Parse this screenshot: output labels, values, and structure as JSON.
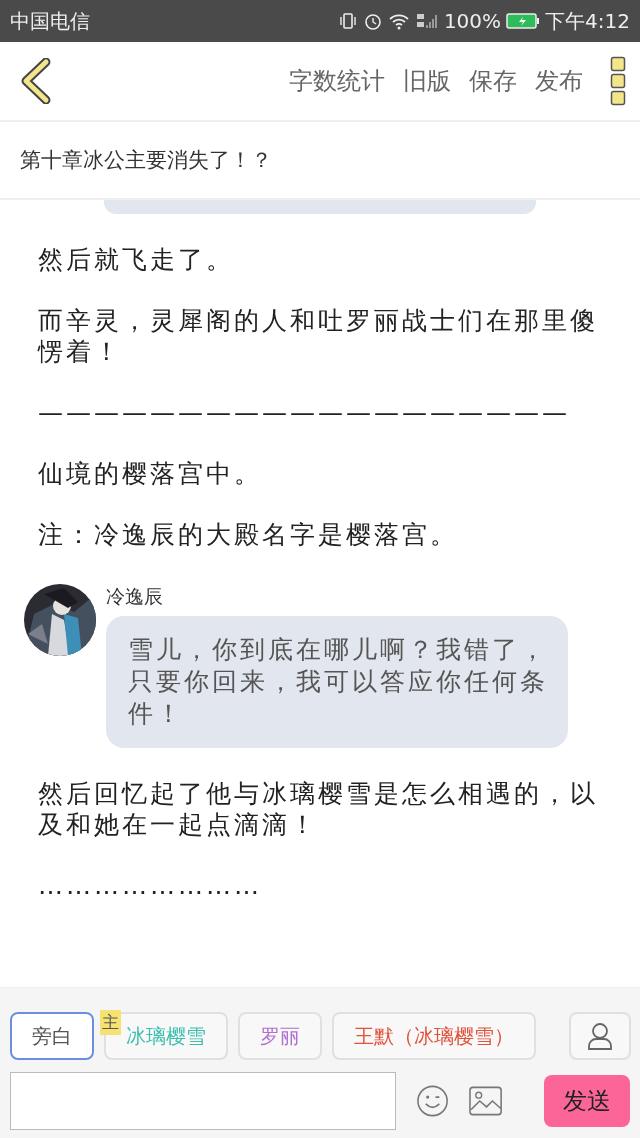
{
  "status_bar": {
    "carrier": "中国电信",
    "battery": "100%",
    "time": "下午4:12"
  },
  "toolbar": {
    "actions": [
      "字数统计",
      "旧版",
      "保存",
      "发布"
    ]
  },
  "chapter_title": "第十章冰公主要消失了！？",
  "content": [
    {
      "kind": "bubble_tail"
    },
    {
      "kind": "text",
      "text": "然后就飞走了。"
    },
    {
      "kind": "text",
      "text": "而辛灵，灵犀阁的人和吐罗丽战士们在那里傻愣着！"
    },
    {
      "kind": "text",
      "text": "———————————————————"
    },
    {
      "kind": "text",
      "text": "仙境的樱落宫中。"
    },
    {
      "kind": "text",
      "text": "注：冷逸辰的大殿名字是樱落宫。"
    },
    {
      "kind": "dialog",
      "speaker": "冷逸辰",
      "text": "雪儿，你到底在哪儿啊？我错了，只要你回来，我可以答应你任何条件！"
    },
    {
      "kind": "text",
      "text": "然后回忆起了他与冰璃樱雪是怎么相遇的，以及和她在一起点滴滴！"
    },
    {
      "kind": "text",
      "text": "……………………"
    }
  ],
  "characters": [
    {
      "name": "旁白",
      "color": "#555555",
      "selected": true
    },
    {
      "name": "冰璃樱雪",
      "color": "#3cbfae",
      "selected": false,
      "badge": "主"
    },
    {
      "name": "罗丽",
      "color": "#b070d0",
      "selected": false
    },
    {
      "name": "王默（冰璃樱雪）",
      "color": "#e0523a",
      "selected": false
    }
  ],
  "composer": {
    "send": "发送"
  }
}
